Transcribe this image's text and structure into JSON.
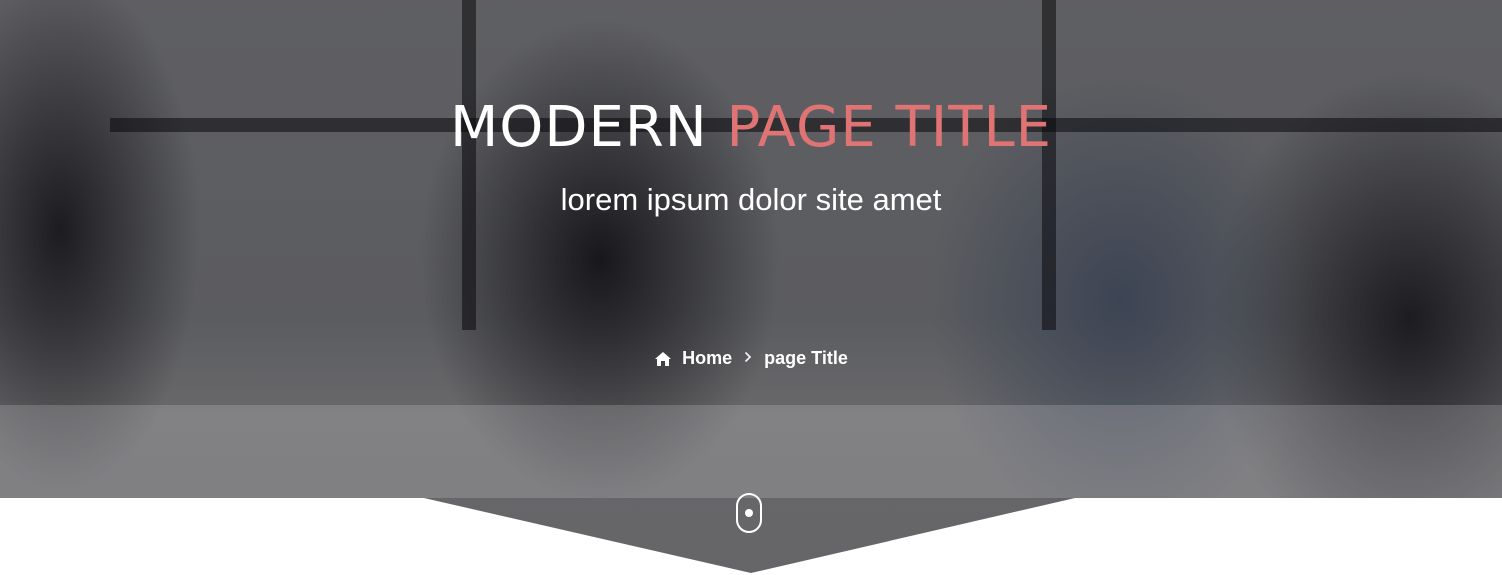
{
  "hero": {
    "title_main": "MODERN",
    "title_accent": "PAGE TITLE",
    "subtitle": "lorem ipsum dolor site amet",
    "accent_color": "#e07373"
  },
  "breadcrumb": {
    "home_icon": "home-icon",
    "home_label": "Home",
    "separator_icon": "chevron-right-icon",
    "current_label": "page Title"
  },
  "scroll_indicator": {
    "icon": "mouse-scroll-icon"
  }
}
